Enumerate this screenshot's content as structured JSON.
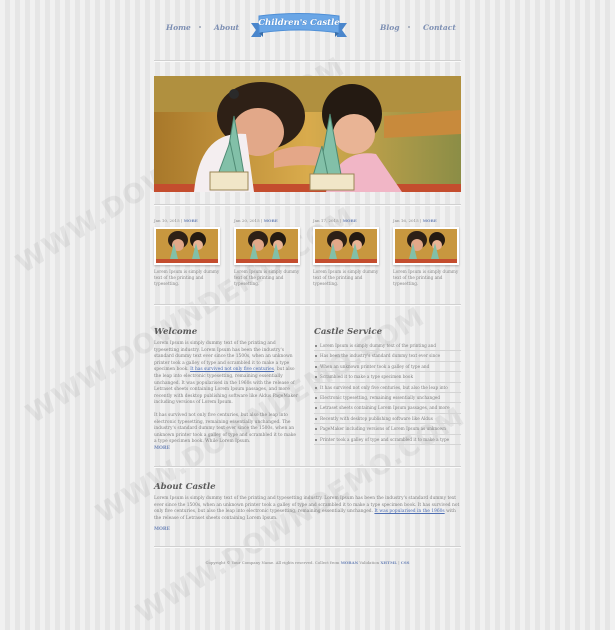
{
  "nav": {
    "home": "Home",
    "about": "About",
    "logo": "Children's Castle",
    "blog": "Blog",
    "contact": "Contact"
  },
  "posts": [
    {
      "date": "Jan 10, 2015 |",
      "more": "MORE",
      "caption": "Lorem Ipsum is simply dummy text of the printing and typesetting."
    },
    {
      "date": "Jan 20, 2015 |",
      "more": "MORE",
      "caption": "Lorem Ipsum is simply dummy text of the printing and typesetting."
    },
    {
      "date": "Jan 17, 2015 |",
      "more": "MORE",
      "caption": "Lorem Ipsum is simply dummy text of the printing and typesetting."
    },
    {
      "date": "Jan 16, 2015 |",
      "more": "MORE",
      "caption": "Lorem Ipsum is simply dummy text of the printing and typesetting."
    }
  ],
  "welcome": {
    "title": "Welcome",
    "p1a": "Lorem Ipsum is simply dummy text of the printing and typesetting industry. Lorem Ipsum has been the industry's standard dummy text ever since the 1500s, when an unknown printer took a galley of type and scrambled it to make a type specimen book. ",
    "p1link": "It has survived not only five centuries",
    "p1b": ", but also the leap into electronic typesetting, remaining essentially unchanged. It was popularised in the 1960s with the release of Letraset sheets containing Lorem Ipsum passages, and more recently with desktop publishing software like Aldus PageMaker including versions of Lorem Ipsum.",
    "p2": "It has survived not only five centuries, but also the leap into electronic typesetting, remaining essentially unchanged. The industry's standard dummy text ever since the 1500s, when an unknown printer took a galley of type and scrambled it to make a type specimen book. While Lorem Ipsum.",
    "more": "MORE"
  },
  "service": {
    "title": "Castle Service",
    "items": [
      "Lorem Ipsum is simply dummy text of the printing and",
      "Has been the industry's standard dummy text ever since",
      "When an unknown printer took a galley of type and",
      "Scrambled it to make a type specimen book",
      "It has survived not only five centuries, but also the leap into",
      "Electronic typesetting, remaining essentially unchanged",
      "Letraset sheets containing Lorem Ipsum passages, and more",
      "Recently with desktop publishing software like Aldus",
      "PageMaker including versions of Lorem Ipsum as unknown",
      "Printer took a galley of type and scrambled it to make a type"
    ]
  },
  "about": {
    "title": "About Castle",
    "texta": "Lorem Ipsum is simply dummy text of the printing and typesetting industry. Lorem Ipsum has been the industry's standard dummy text ever since the 1500s, when an unknown printer took a galley of type and scrambled it to make a type specimen book. It has survived not only five centuries, but also the leap into electronic typesetting, remaining essentially unchanged. ",
    "textlink": "It was popularised in the 1960s",
    "textb": " with the release of Letraset sheets containing Lorem Ipsum.",
    "more": "MORE"
  },
  "footer": {
    "text": "Copyright © Your Company Name. All rights reserved. Collect from ",
    "link1": "MOBAN",
    "mid": " Validation ",
    "link2": "XHTML",
    "sep": " | ",
    "link3": "CSS"
  },
  "watermark": "WWW.DOWNDEMO.COM",
  "colors": {
    "accent": "#6f86b8",
    "logo_ribbon": "#6aa6e6",
    "text": "#808080"
  }
}
